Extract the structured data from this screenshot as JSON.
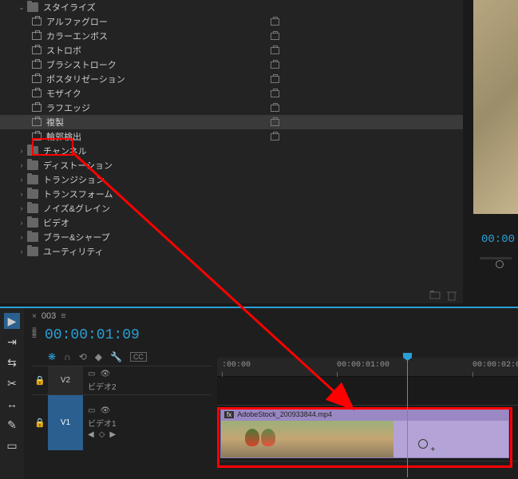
{
  "effects": {
    "category": "スタイライズ",
    "items": [
      "アルファグロー",
      "カラーエンボス",
      "ストロボ",
      "ブラシストローク",
      "ポスタリゼーション",
      "モザイク",
      "ラフエッジ",
      "複製",
      "輪郭検出"
    ],
    "folders": [
      "チャンネル",
      "ディストーション",
      "トランジション",
      "トランスフォーム",
      "ノイズ&グレイン",
      "ビデオ",
      "ブラー&シャープ",
      "ユーティリティ"
    ],
    "selected_index": 7
  },
  "preview": {
    "timecode": "00:00"
  },
  "timeline": {
    "sequence_name": "003",
    "playhead_timecode": "00:00:01:09",
    "ruler": [
      ":00:00",
      "00:00:01:00",
      "00:00:02:0"
    ],
    "tracks": {
      "v2": {
        "id": "V2",
        "name": "ビデオ2"
      },
      "v1": {
        "id": "V1",
        "name": "ビデオ1"
      }
    },
    "clip": {
      "name": "AdobeStock_200933844.mp4",
      "fx": "fx"
    }
  },
  "tools": [
    "selection",
    "track-select",
    "ripple",
    "razor",
    "slip",
    "pen",
    "rectangle"
  ]
}
